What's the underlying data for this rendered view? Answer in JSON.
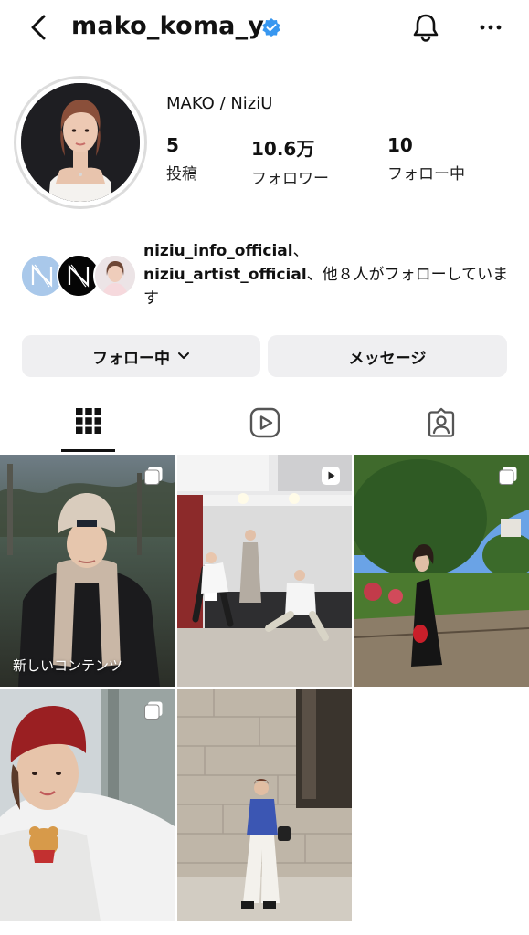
{
  "header": {
    "username": "mako_koma_y"
  },
  "profile": {
    "display_name": "MAKO / NiziU",
    "stats": [
      {
        "value": "5",
        "label": "投稿"
      },
      {
        "value": "10.6万",
        "label": "フォロワー"
      },
      {
        "value": "10",
        "label": "フォロー中"
      }
    ]
  },
  "followed_by": {
    "account1": "niziu_info_official",
    "sep": "、",
    "account2": "niziu_artist_official",
    "suffix": "、他８人がフォローしています"
  },
  "buttons": {
    "following_label": "フォロー中",
    "message_label": "メッセージ"
  },
  "tabs": [
    {
      "icon": "grid-icon",
      "active": true
    },
    {
      "icon": "reels-icon",
      "active": false
    },
    {
      "icon": "tagged-icon",
      "active": false
    }
  ],
  "posts": [
    {
      "badge": "carousel-icon",
      "overlay_text": "新しいコンテンツ"
    },
    {
      "badge": "reel-play-icon"
    },
    {
      "badge": "carousel-icon"
    },
    {
      "badge": "carousel-icon"
    },
    {
      "badge": ""
    }
  ],
  "colors": {
    "verified": "#3897f0",
    "button_bg": "#efeff1",
    "text": "#111111"
  }
}
